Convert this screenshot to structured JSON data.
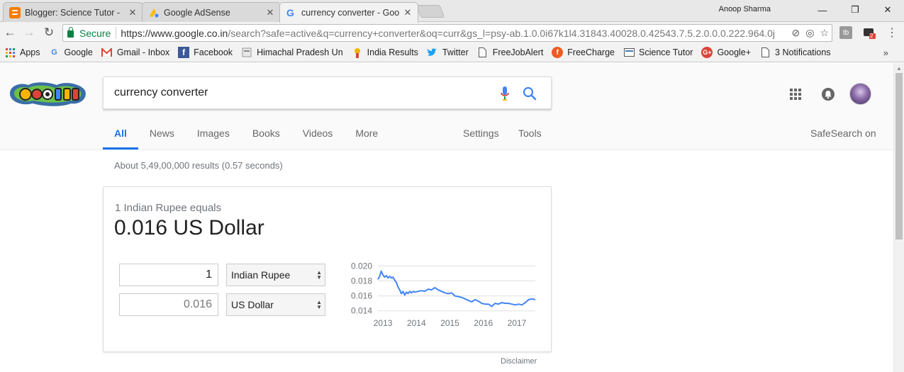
{
  "browser": {
    "tabs": [
      {
        "title": "Blogger: Science Tutor -",
        "icon": "blogger-icon",
        "color": "#f57d00"
      },
      {
        "title": "Google AdSense",
        "icon": "adsense-icon",
        "color": "#fbbc04"
      },
      {
        "title": "currency converter - Goo",
        "icon": "google-icon",
        "color": "#4285f4"
      }
    ],
    "profile_name": "Anoop Sharma",
    "secure_label": "Secure",
    "url_host": "https://www.google.co.in",
    "url_rest": "/search?safe=active&q=currency+converter&oq=curr&gs_l=psy-ab.1.0.0i67k1l4.31843.40028.0.42543.7.5.2.0.0.0.222.964.0j...",
    "ext_badge": "2"
  },
  "bookmarks": [
    {
      "label": "Apps",
      "icon": "apps-icon"
    },
    {
      "label": "Google",
      "icon": "google-icon"
    },
    {
      "label": "Gmail - Inbox",
      "icon": "gmail-icon"
    },
    {
      "label": "Facebook",
      "icon": "facebook-icon"
    },
    {
      "label": "Himachal Pradesh Un",
      "icon": "page-icon"
    },
    {
      "label": "India Results",
      "icon": "results-icon"
    },
    {
      "label": "Twitter",
      "icon": "twitter-icon"
    },
    {
      "label": "FreeJobAlert",
      "icon": "document-icon"
    },
    {
      "label": "FreeCharge",
      "icon": "freecharge-icon"
    },
    {
      "label": "Science Tutor",
      "icon": "page-icon"
    },
    {
      "label": "Google+",
      "icon": "google-plus-icon"
    },
    {
      "label": "3 Notifications",
      "icon": "document-icon"
    }
  ],
  "search": {
    "query": "currency converter",
    "tabs": [
      "All",
      "News",
      "Images",
      "Books",
      "Videos",
      "More"
    ],
    "active_tab": "All",
    "settings_label": "Settings",
    "tools_label": "Tools",
    "safesearch_label": "SafeSearch on",
    "stats": "About 5,49,00,000 results (0.57 seconds)"
  },
  "converter": {
    "equals_text": "1 Indian Rupee equals",
    "result_text": "0.016 US Dollar",
    "from_amount": "1",
    "from_currency": "Indian Rupee",
    "to_amount": "0.016",
    "to_currency": "US Dollar",
    "disclaimer": "Disclaimer"
  },
  "chart_data": {
    "type": "line",
    "title": "",
    "xlabel": "",
    "ylabel": "",
    "x_ticks": [
      "2013",
      "2014",
      "2015",
      "2016",
      "2017"
    ],
    "y_ticks": [
      "0.020",
      "0.018",
      "0.016",
      "0.014"
    ],
    "xlim": [
      2012.9,
      2017.6
    ],
    "ylim": [
      0.0135,
      0.0205
    ],
    "color": "#4285f4",
    "series": [
      {
        "x": [
          2012.9,
          2012.95,
          2013.0,
          2013.05,
          2013.1,
          2013.15,
          2013.2,
          2013.25,
          2013.3,
          2013.35,
          2013.4,
          2013.45,
          2013.5,
          2013.55,
          2013.6,
          2013.65,
          2013.7,
          2013.75,
          2013.8,
          2013.85,
          2013.9,
          2013.95,
          2014.0,
          2014.1,
          2014.2,
          2014.3,
          2014.4,
          2014.5,
          2014.6,
          2014.7,
          2014.8,
          2014.9,
          2015.0,
          2015.1,
          2015.2,
          2015.3,
          2015.4,
          2015.5,
          2015.6,
          2015.7,
          2015.8,
          2015.9,
          2016.0,
          2016.1,
          2016.2,
          2016.3,
          2016.4,
          2016.5,
          2016.6,
          2016.7,
          2016.8,
          2016.9,
          2017.0,
          2017.1,
          2017.2,
          2017.3,
          2017.4,
          2017.5,
          2017.6
        ],
        "values": [
          0.0182,
          0.0186,
          0.0193,
          0.0188,
          0.0185,
          0.0187,
          0.0184,
          0.0186,
          0.0184,
          0.0185,
          0.0181,
          0.0178,
          0.0172,
          0.0168,
          0.0163,
          0.0166,
          0.0161,
          0.0165,
          0.0163,
          0.0166,
          0.0164,
          0.0166,
          0.0165,
          0.0166,
          0.0167,
          0.0166,
          0.0169,
          0.0168,
          0.0171,
          0.0168,
          0.0166,
          0.0164,
          0.0163,
          0.0164,
          0.016,
          0.0159,
          0.0158,
          0.0156,
          0.0154,
          0.0152,
          0.0155,
          0.0153,
          0.015,
          0.0149,
          0.0149,
          0.0146,
          0.015,
          0.0149,
          0.0151,
          0.015,
          0.015,
          0.0149,
          0.0148,
          0.0149,
          0.0148,
          0.0151,
          0.0155,
          0.0156,
          0.0155
        ]
      }
    ]
  }
}
